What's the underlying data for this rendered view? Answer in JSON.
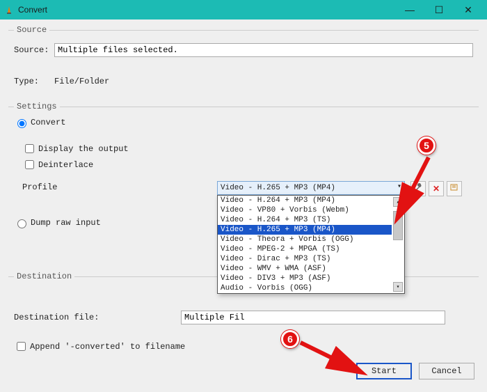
{
  "window": {
    "title": "Convert",
    "icon_name": "vlc-cone-icon"
  },
  "source_section": {
    "legend": "Source",
    "source_label": "Source:",
    "source_value": "Multiple files selected.",
    "type_label": "Type:",
    "type_value": "File/Folder"
  },
  "settings_section": {
    "legend": "Settings",
    "convert_radio": "Convert",
    "display_output": "Display the output",
    "deinterlace": "Deinterlace",
    "profile_label": "Profile",
    "profile_selected": "Video - H.265 + MP3 (MP4)",
    "profile_options": [
      "Video - H.264 + MP3 (MP4)",
      "Video - VP80 + Vorbis (Webm)",
      "Video - H.264 + MP3 (TS)",
      "Video - H.265 + MP3 (MP4)",
      "Video - Theora + Vorbis (OGG)",
      "Video - MPEG-2 + MPGA (TS)",
      "Video - Dirac + MP3 (TS)",
      "Video - WMV + WMA (ASF)",
      "Video - DIV3 + MP3 (ASF)",
      "Audio - Vorbis (OGG)"
    ],
    "profile_selected_index": 3,
    "dump_raw": "Dump raw input"
  },
  "destination_section": {
    "legend": "Destination",
    "dest_file_label": "Destination file:",
    "dest_file_value": "Multiple Fil",
    "append_label": "Append '-converted' to filename"
  },
  "buttons": {
    "start": "Start",
    "cancel": "Cancel"
  },
  "annotations": {
    "callout5": "5",
    "callout6": "6"
  }
}
